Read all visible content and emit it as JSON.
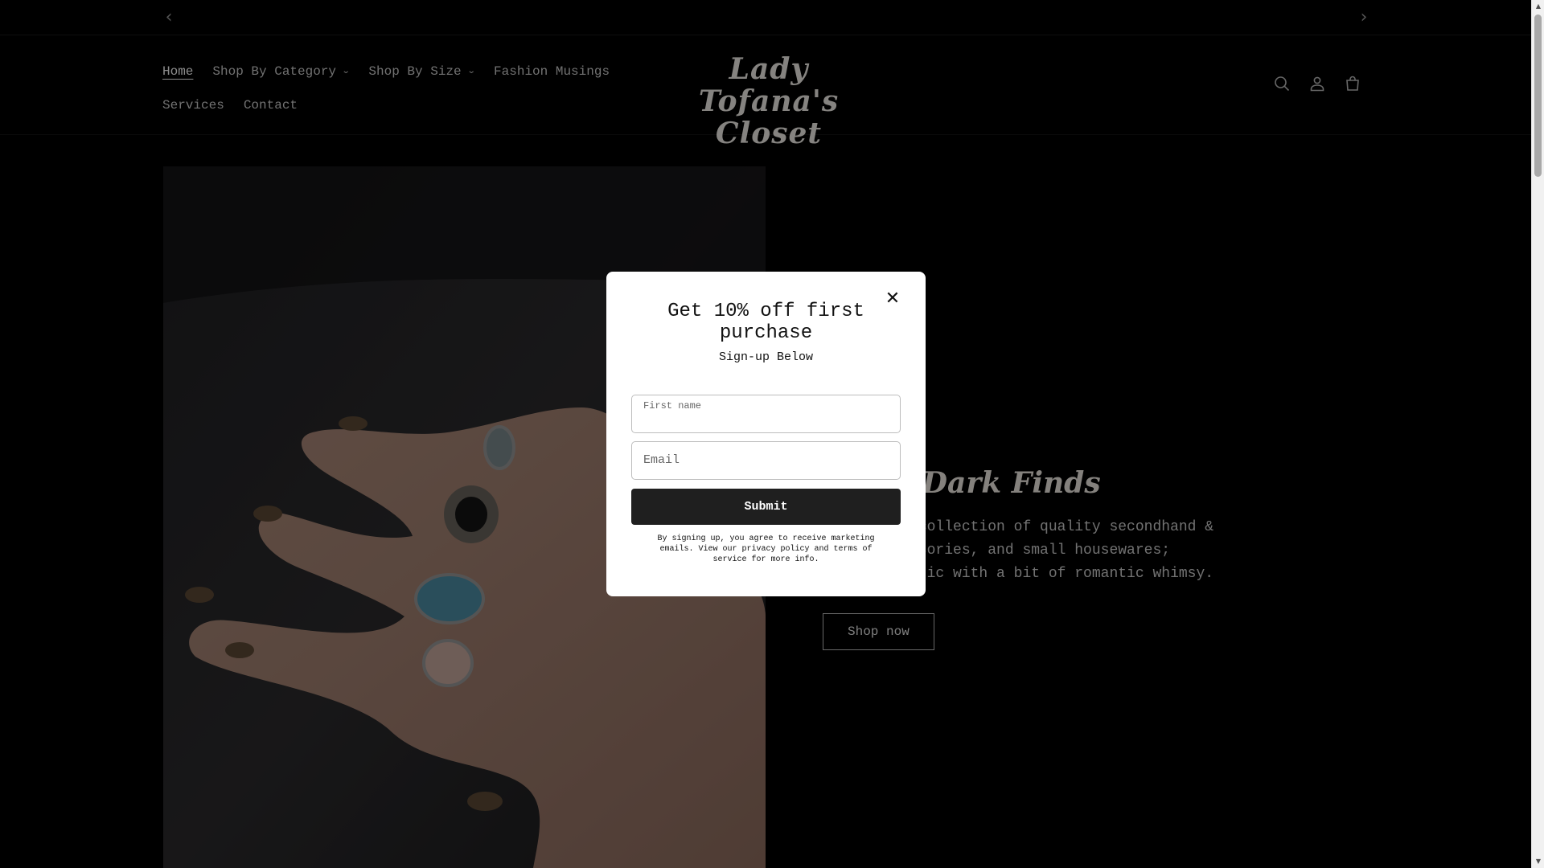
{
  "announcement": {
    "prev_icon": "chevron-left-icon",
    "next_icon": "chevron-right-icon"
  },
  "header": {
    "logo_text": "Lady Tofana's Closet",
    "nav": [
      {
        "label": "Home",
        "active": true
      },
      {
        "label": "Shop By Category",
        "dropdown": true
      },
      {
        "label": "Shop By Size",
        "dropdown": true
      },
      {
        "label": "Fashion Musings"
      },
      {
        "label": "Services"
      },
      {
        "label": "Contact"
      }
    ],
    "icons": [
      "search-icon",
      "account-icon",
      "cart-icon"
    ]
  },
  "hero": {
    "title": "-Kind Dark Finds",
    "description_lines": [
      "enchanting collection of quality secondhand &",
      "hing, accessories, and small housewares;",
      "dark aesthetic with a bit of romantic whimsy."
    ],
    "button_label": "Shop now"
  },
  "modal": {
    "title": "Get 10% off first purchase",
    "subtitle": "Sign-up Below",
    "first_name_label": "First name",
    "email_label": "Email",
    "submit_label": "Submit",
    "disclaimer": "By signing up, you agree to receive marketing emails. View our privacy policy and terms of service for more info."
  },
  "colors": {
    "page_bg": "#000000",
    "modal_bg": "#ffffff",
    "submit_bg": "#1f1f1f"
  }
}
